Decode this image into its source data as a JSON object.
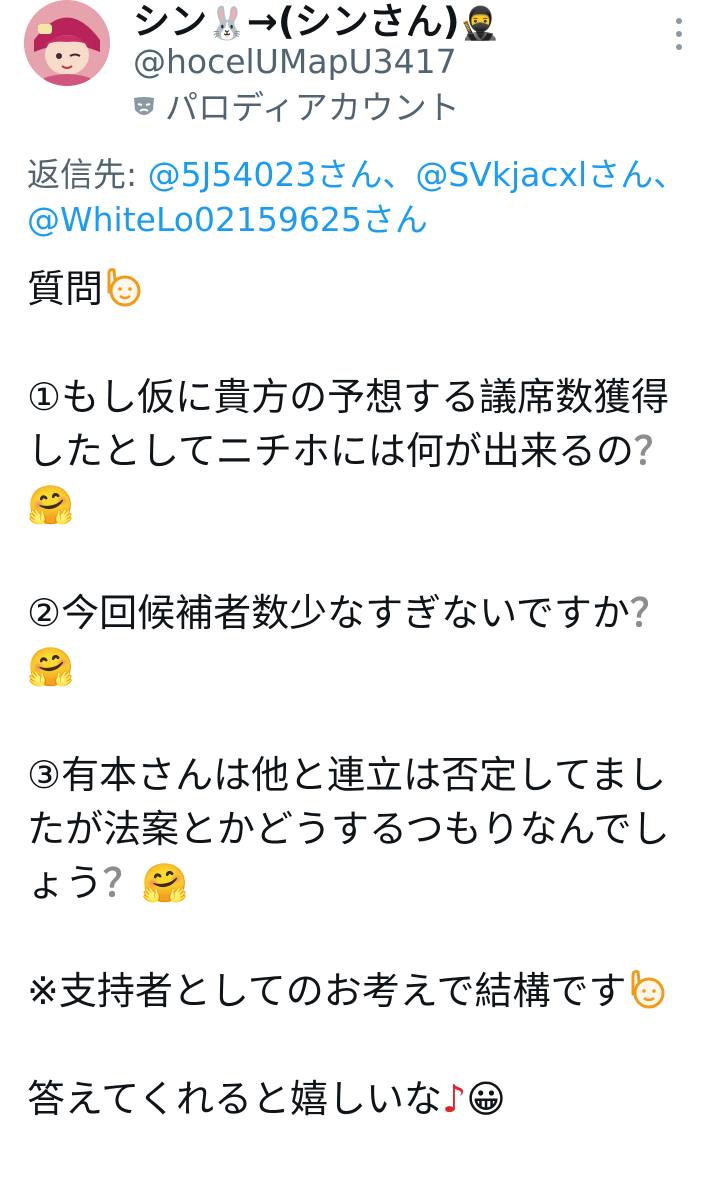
{
  "author": {
    "display_name_prefix": "シン",
    "display_name_emoji1": "🐰",
    "display_name_suffix": "→(シンさん)",
    "display_name_emoji2": "🥷",
    "handle": "@hocelUMapU3417",
    "parody_label": "パロディアカウント"
  },
  "reply": {
    "prefix": "返信先: ",
    "mentions": [
      "@5J54023さん",
      "@SVkjacxlさん",
      "@WhiteLo02159625さん"
    ],
    "separator": "、"
  },
  "body": {
    "line_question": "質問",
    "q1_text": "①もし仮に貴方の予想する議席数獲得したとしてニチホには何が出来るの",
    "q2_text": "②今回候補者数少なすぎないですか",
    "q3_text": "③有本さんは他と連立は否定してましたが法案とかどうするつもりなんでしょう",
    "note_text": "※支持者としてのお考えで結構です",
    "closing_text": "答えてくれると嬉しいな",
    "question_mark": "？",
    "hug_emoji": "🤗",
    "grin_emoji": "😀",
    "music_note": "♪"
  },
  "colors": {
    "link": "#1d9bf0",
    "secondary_text": "#536471",
    "primary_text": "#0f1419",
    "note_red": "#e0242f"
  },
  "icons": {
    "more": "more-vertical-icon",
    "parody": "theater-mask-icon",
    "raise_hand": "raising-hand-icon"
  }
}
